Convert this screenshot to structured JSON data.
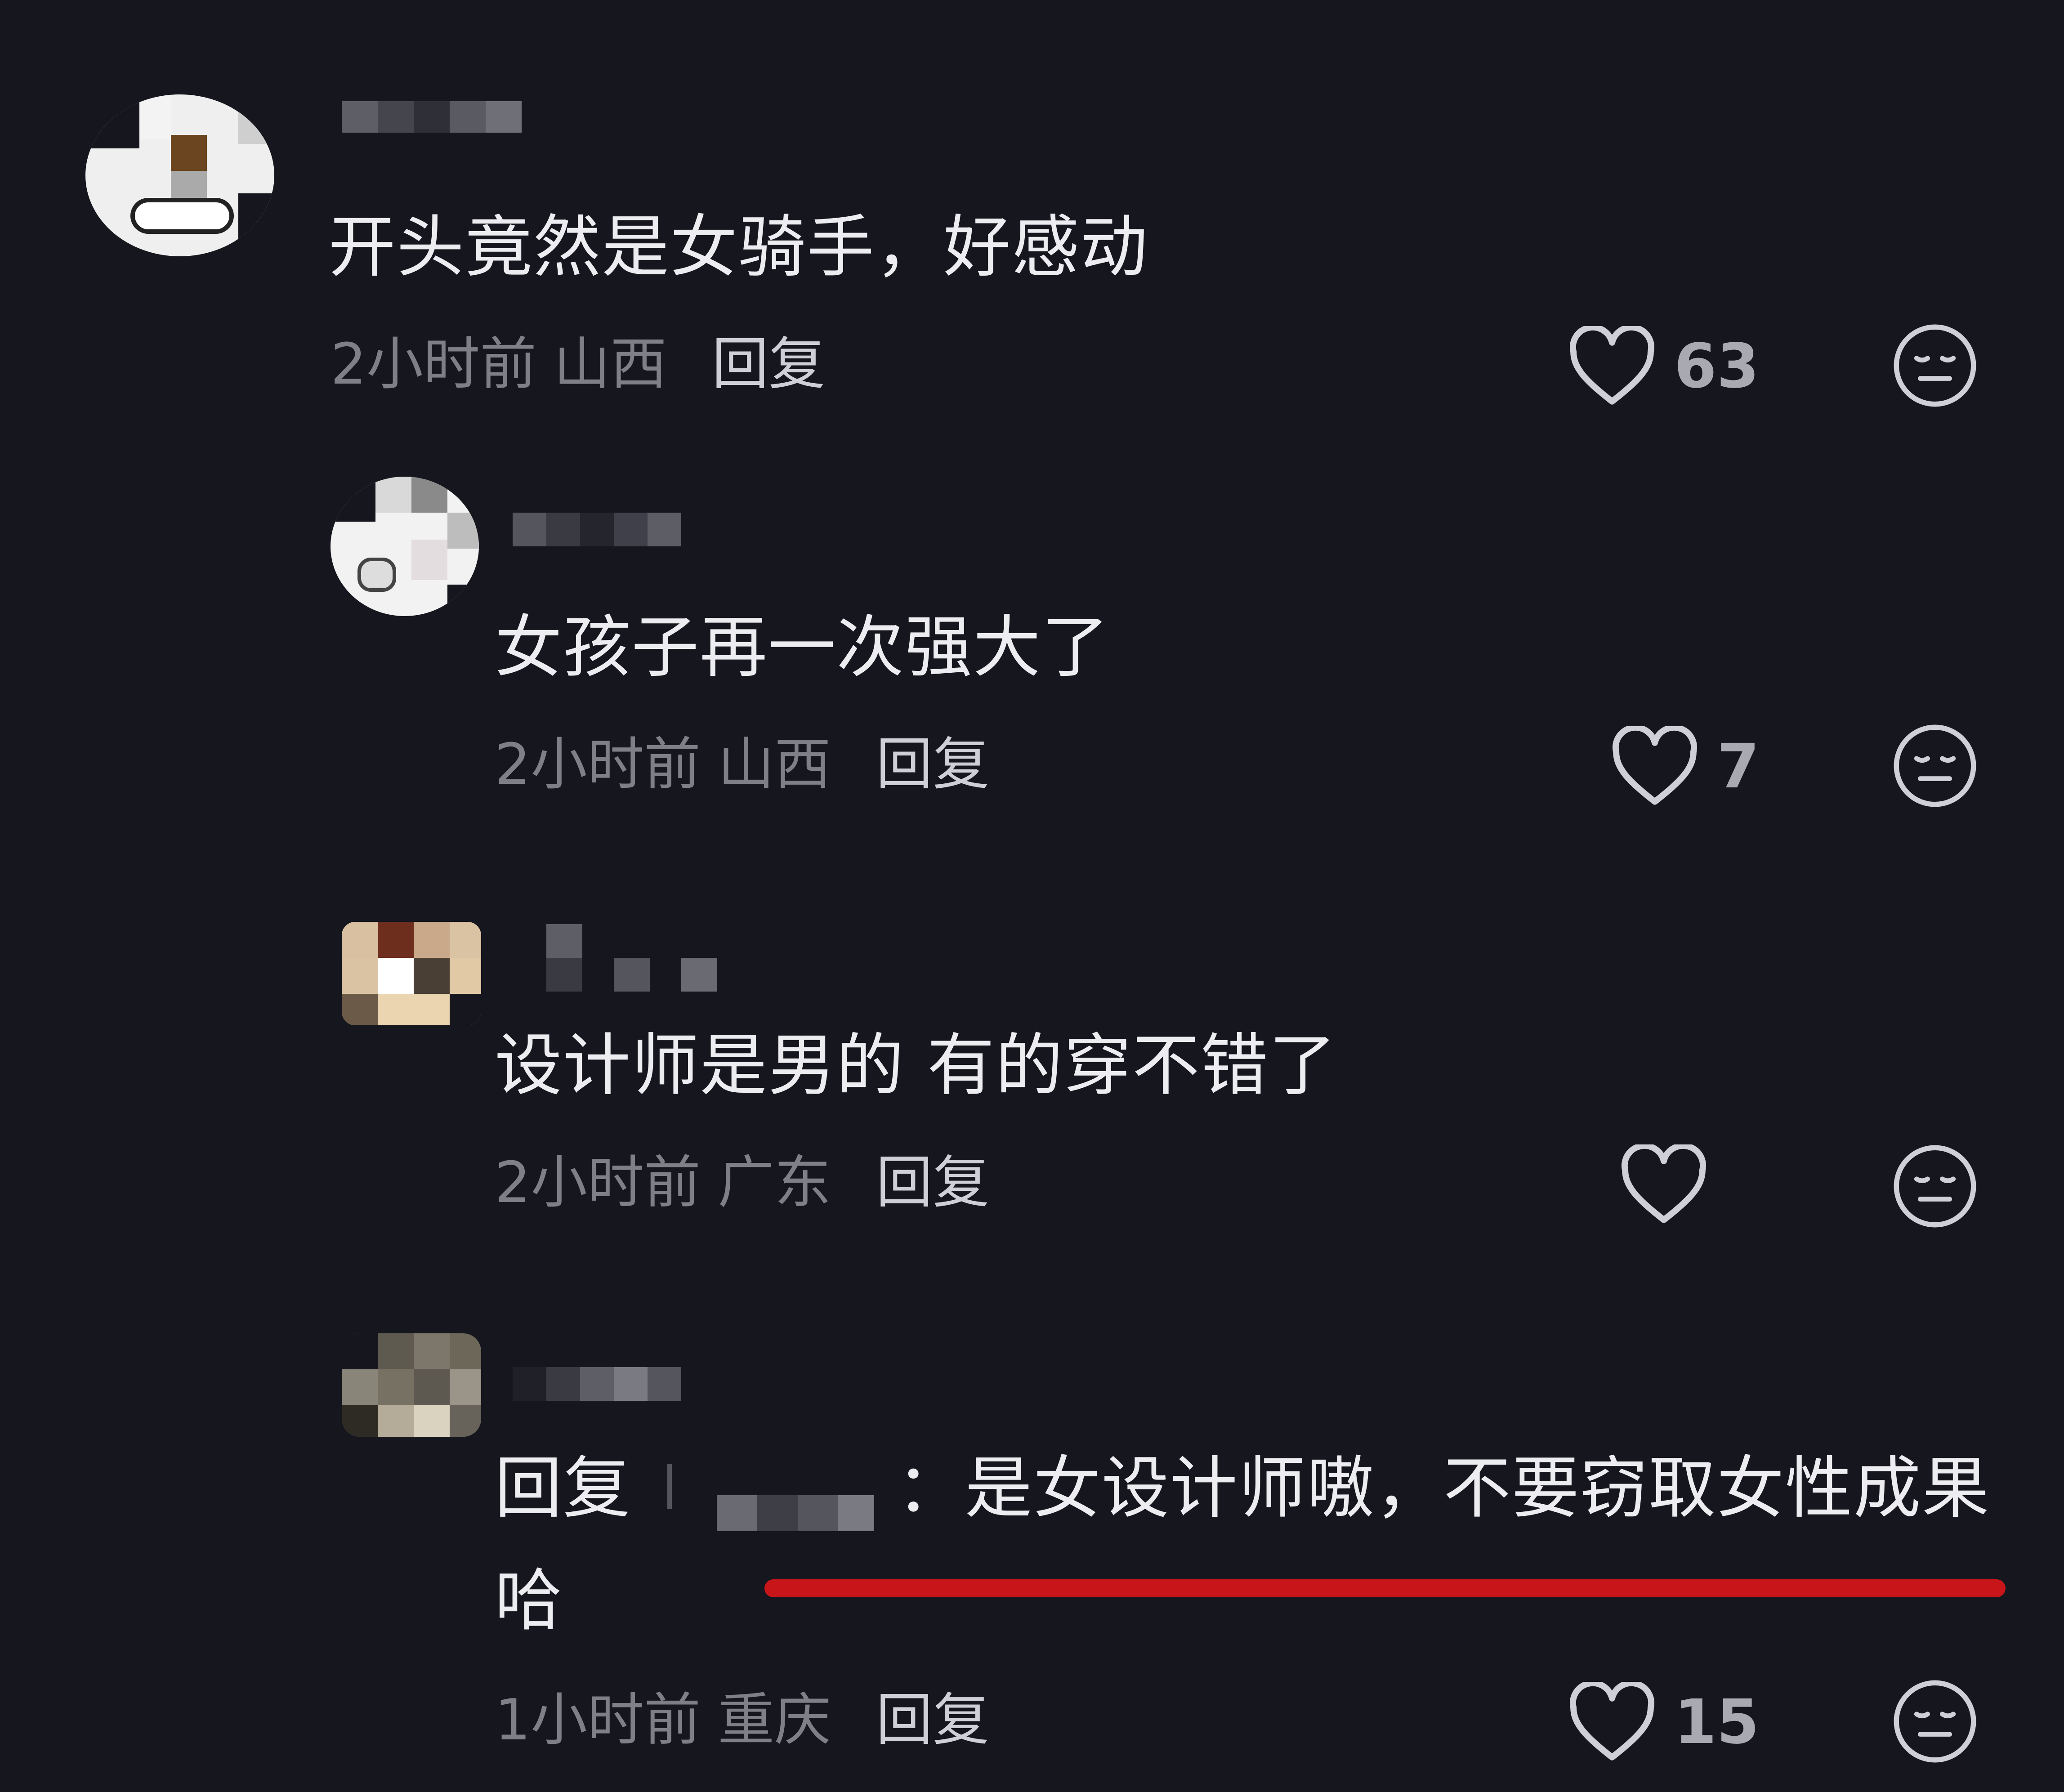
{
  "comments": [
    {
      "text": "开头竟然是女骑手，好感动",
      "time": "2小时前",
      "location": "山西",
      "reply_label": "回复",
      "likes": "63"
    },
    {
      "text": "女孩子再一次强大了",
      "time": "2小时前",
      "location": "山西",
      "reply_label": "回复",
      "likes": "7"
    },
    {
      "text": "设计师是男的 有的穿不错了",
      "time": "2小时前",
      "location": "广东",
      "reply_label": "回复",
      "likes": ""
    },
    {
      "reply_prefix": "回复",
      "text": "：是女设计师嗷，不要窃取女性成果",
      "text_line2": "哈",
      "time": "1小时前",
      "location": "重庆",
      "reply_label": "回复",
      "likes": "15"
    }
  ],
  "icons": {
    "like": "heart-outline-icon",
    "dislike": "meh-face-icon"
  },
  "colors": {
    "background": "#16161e",
    "text": "#ececf1",
    "meta": "#7f7f88",
    "highlight_underline": "#c8151a"
  }
}
